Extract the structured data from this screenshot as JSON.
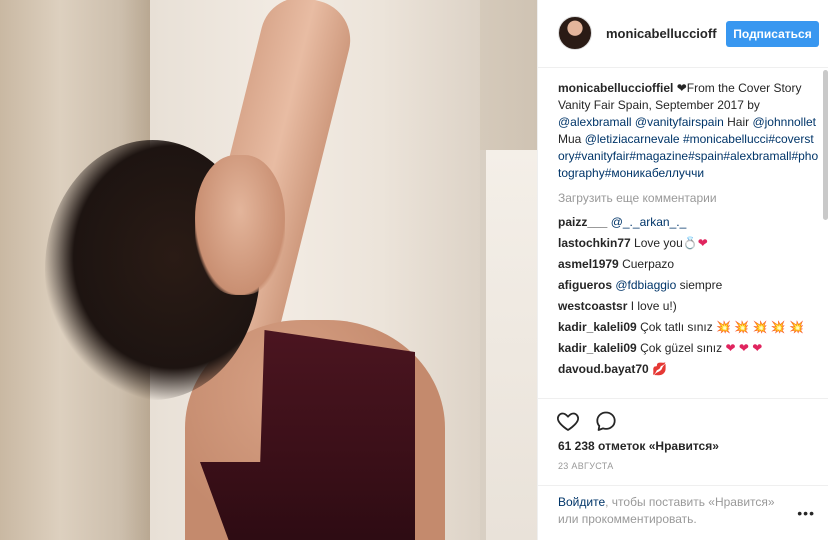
{
  "header": {
    "username": "monicabelluccioff",
    "follow_label": "Подписаться"
  },
  "caption": {
    "author": "monicabelluccioffiel",
    "heart": "❤",
    "text_1": "From the Cover Story Vanity Fair Spain, September 2017 by ",
    "mention_1": "@alexbramall",
    "space_1": " ",
    "mention_2": "@vanityfairspain",
    "text_2": " Hair ",
    "mention_3": "@johnnollet",
    "text_3": " Mua ",
    "mention_4": "@letiziacarnevale",
    "hashtags": "#monicabellucci#coverstory#vanityfair#magazine#spain#alexbramall#photography#моникабеллуччи"
  },
  "load_more": "Загрузить еще комментарии",
  "comments": [
    {
      "author": "paizz___",
      "text_prefix": "",
      "mention": "@_._arkan_._",
      "text": "",
      "emoji": ""
    },
    {
      "author": "lastochkin77",
      "text_prefix": "Love you",
      "mention": "",
      "text": "",
      "emoji": "💍❤"
    },
    {
      "author": "asmel1979",
      "text_prefix": "Cuerpazo",
      "mention": "",
      "text": "",
      "emoji": ""
    },
    {
      "author": "afigueros",
      "text_prefix": "",
      "mention": "@fdbiaggio",
      "text": " siempre",
      "emoji": ""
    },
    {
      "author": "westcoastsr",
      "text_prefix": "I love u!)",
      "mention": "",
      "text": "",
      "emoji": ""
    },
    {
      "author": "kadir_kaleli09",
      "text_prefix": "Çok tatlı sınız ",
      "mention": "",
      "text": "",
      "emoji": "💥 💥 💥 💥 💥"
    },
    {
      "author": "kadir_kaleli09",
      "text_prefix": "Çok güzel sınız ",
      "mention": "",
      "text": "",
      "emoji": "❤ ❤ ❤"
    },
    {
      "author": "davoud.bayat70",
      "text_prefix": "",
      "mention": "",
      "text": "",
      "emoji": "💋"
    }
  ],
  "likes": "61 238 отметок «Нравится»",
  "date": "23 АВГУСТА",
  "footer": {
    "login_link": "Войдите",
    "login_rest": ", чтобы поставить «Нравится» или прокомментировать.",
    "more": "•••"
  },
  "icons": {
    "like": "heart-outline-icon",
    "comment": "speech-bubble-icon",
    "more": "ellipsis-icon"
  },
  "colors": {
    "accent": "#3897f0",
    "link": "#003569",
    "muted": "#999999"
  }
}
